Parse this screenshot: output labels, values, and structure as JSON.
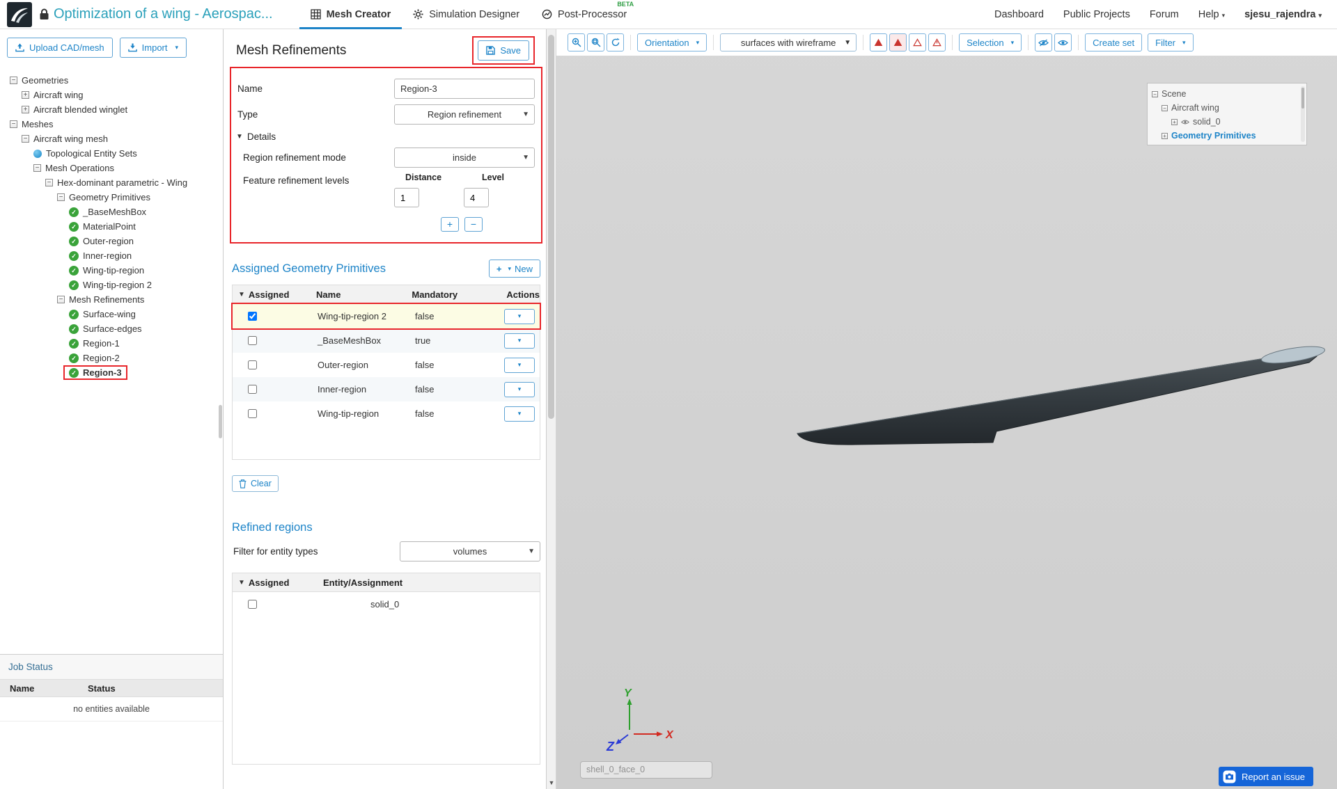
{
  "colors": {
    "accent_blue": "#1d84c8",
    "title_teal": "#2aa0ba",
    "annotation_red": "#e8252a",
    "check_green": "#3aa33a",
    "warning_red": "#c9342e",
    "report_blue": "#1565d8"
  },
  "header": {
    "project_title": "Optimization of a wing - Aerospac...",
    "tabs": [
      {
        "label": "Mesh Creator",
        "active": true
      },
      {
        "label": "Simulation Designer",
        "active": false
      },
      {
        "label": "Post-Processor",
        "active": false,
        "badge": "BETA"
      }
    ],
    "nav": [
      "Dashboard",
      "Public Projects",
      "Forum"
    ],
    "help_label": "Help",
    "user": "sjesu_rajendra"
  },
  "sidebar": {
    "upload_button": "Upload CAD/mesh",
    "import_button": "Import",
    "tree": [
      {
        "depth": 0,
        "expander": "minus",
        "icon": "",
        "label": "Geometries"
      },
      {
        "depth": 1,
        "expander": "plus",
        "icon": "",
        "label": "Aircraft wing"
      },
      {
        "depth": 1,
        "expander": "plus",
        "icon": "",
        "label": "Aircraft blended winglet"
      },
      {
        "depth": 0,
        "expander": "minus",
        "icon": "",
        "label": "Meshes"
      },
      {
        "depth": 1,
        "expander": "minus",
        "icon": "",
        "label": "Aircraft wing mesh"
      },
      {
        "depth": 2,
        "expander": "",
        "icon": "dot",
        "label": "Topological Entity Sets"
      },
      {
        "depth": 2,
        "expander": "minus",
        "icon": "",
        "label": "Mesh Operations"
      },
      {
        "depth": 3,
        "expander": "minus",
        "icon": "",
        "label": "Hex-dominant parametric - Wing"
      },
      {
        "depth": 4,
        "expander": "minus",
        "icon": "",
        "label": "Geometry Primitives"
      },
      {
        "depth": 5,
        "expander": "",
        "icon": "check",
        "label": "_BaseMeshBox"
      },
      {
        "depth": 5,
        "expander": "",
        "icon": "check",
        "label": "MaterialPoint"
      },
      {
        "depth": 5,
        "expander": "",
        "icon": "check",
        "label": "Outer-region"
      },
      {
        "depth": 5,
        "expander": "",
        "icon": "check",
        "label": "Inner-region"
      },
      {
        "depth": 5,
        "expander": "",
        "icon": "check",
        "label": "Wing-tip-region"
      },
      {
        "depth": 5,
        "expander": "",
        "icon": "check",
        "label": "Wing-tip-region 2"
      },
      {
        "depth": 4,
        "expander": "minus",
        "icon": "",
        "label": "Mesh Refinements"
      },
      {
        "depth": 5,
        "expander": "",
        "icon": "check",
        "label": "Surface-wing"
      },
      {
        "depth": 5,
        "expander": "",
        "icon": "check",
        "label": "Surface-edges"
      },
      {
        "depth": 5,
        "expander": "",
        "icon": "check",
        "label": "Region-1"
      },
      {
        "depth": 5,
        "expander": "",
        "icon": "check",
        "label": "Region-2"
      },
      {
        "depth": 5,
        "expander": "",
        "icon": "check",
        "label": "Region-3",
        "selected": true
      }
    ],
    "job_status": {
      "title": "Job Status",
      "columns": [
        "Name",
        "Status"
      ],
      "empty_text": "no entities available"
    }
  },
  "panel": {
    "title": "Mesh Refinements",
    "save_button": "Save",
    "form": {
      "name_label": "Name",
      "name_value": "Region-3",
      "type_label": "Type",
      "type_value": "Region refinement",
      "details_label": "Details",
      "mode_label": "Region refinement mode",
      "mode_value": "inside",
      "levels_label": "Feature refinement levels",
      "distance_header": "Distance",
      "level_header": "Level",
      "distance_value": "1",
      "level_value": "4",
      "add_button": "+",
      "remove_button": "−"
    },
    "assigned": {
      "title": "Assigned Geometry Primitives",
      "new_button": "New",
      "columns": [
        "Assigned",
        "Name",
        "Mandatory",
        "Actions"
      ],
      "rows": [
        {
          "checked": true,
          "name": "Wing-tip-region 2",
          "mandatory": "false",
          "highlighted": true,
          "annotated": true
        },
        {
          "checked": false,
          "name": "_BaseMeshBox",
          "mandatory": "true"
        },
        {
          "checked": false,
          "name": "Outer-region",
          "mandatory": "false"
        },
        {
          "checked": false,
          "name": "Inner-region",
          "mandatory": "false"
        },
        {
          "checked": false,
          "name": "Wing-tip-region",
          "mandatory": "false"
        }
      ]
    },
    "clear_button": "Clear",
    "refined": {
      "title": "Refined regions",
      "filter_label": "Filter for entity types",
      "filter_value": "volumes",
      "columns": [
        "Assigned",
        "Entity/Assignment"
      ],
      "rows": [
        {
          "checked": false,
          "name": "solid_0"
        }
      ]
    }
  },
  "viewport": {
    "toolbar": {
      "orientation_label": "Orientation",
      "render_mode_value": "surfaces with wireframe",
      "selection_label": "Selection",
      "create_set_label": "Create set",
      "filter_label": "Filter"
    },
    "scene_tree": {
      "scene": "Scene",
      "aircraft_wing": "Aircraft wing",
      "solid": "solid_0",
      "geometry_primitives": "Geometry Primitives"
    },
    "axis": {
      "x": "X",
      "y": "Y",
      "z": "Z"
    },
    "face_label": "shell_0_face_0",
    "report_button": "Report an issue"
  }
}
